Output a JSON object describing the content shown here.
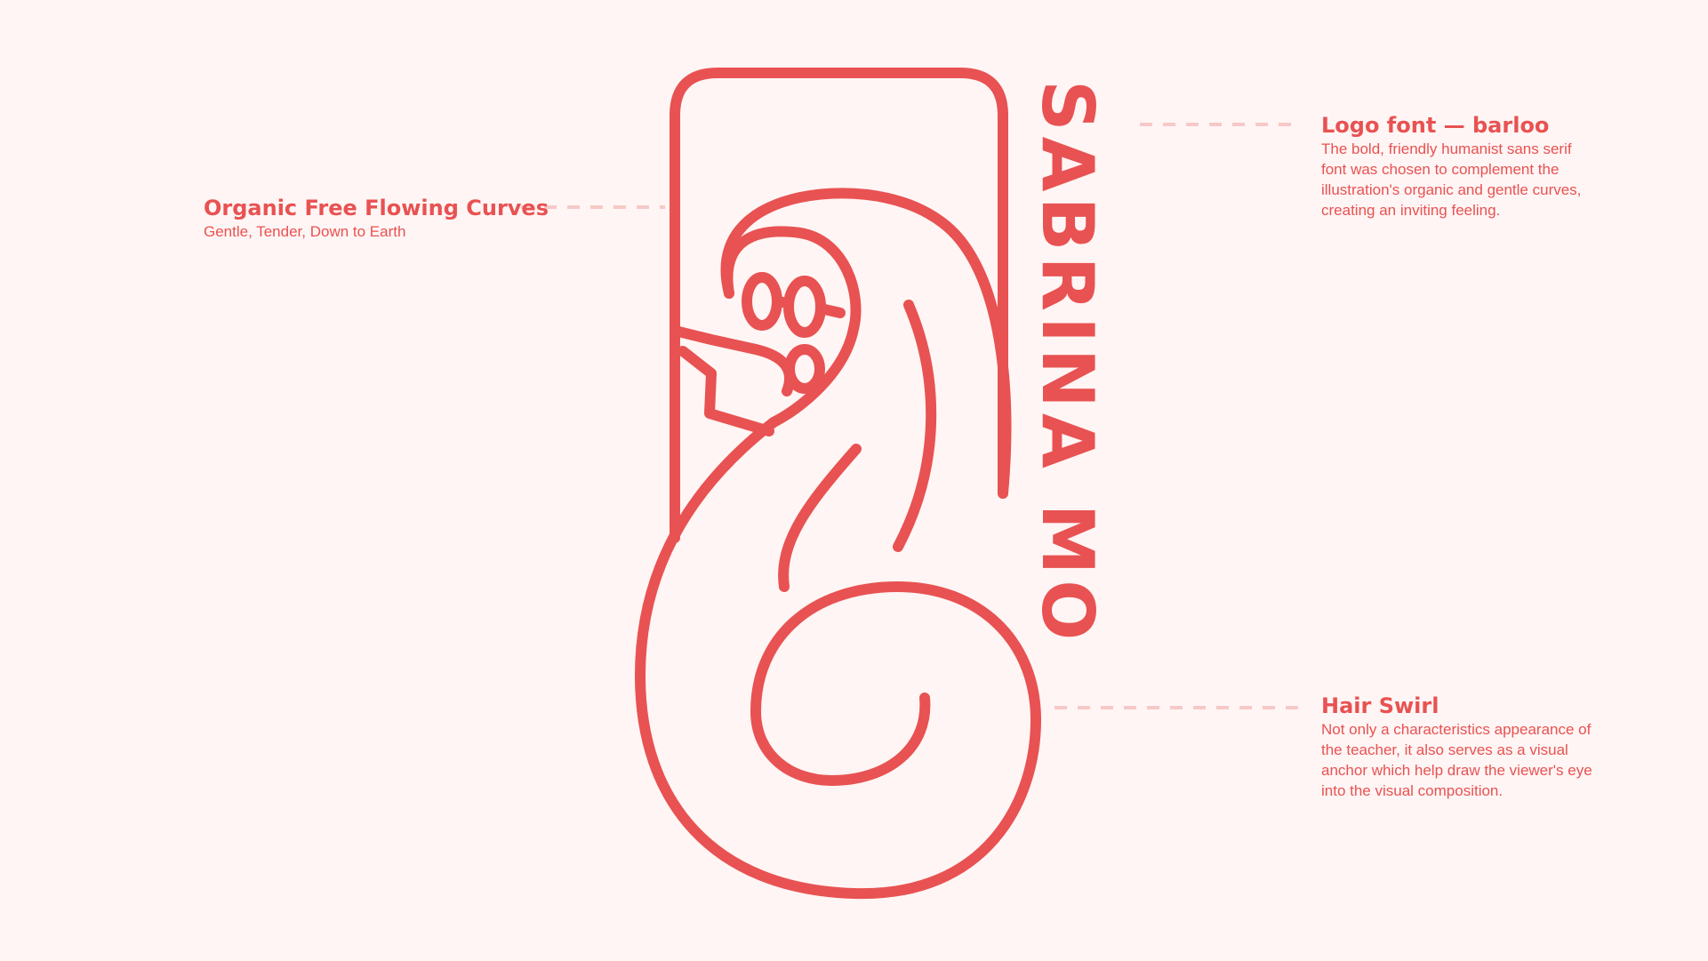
{
  "colors": {
    "background": "#fff5f4",
    "accent": "#e85252",
    "guide_dash": "#f6c9c7"
  },
  "logo": {
    "wordmark": "SABRINA MO"
  },
  "annotations": {
    "curves": {
      "title": "Organic Free Flowing Curves",
      "subtitle": "Gentle, Tender, Down to Earth"
    },
    "font": {
      "title": "Logo font — barloo",
      "description": "The bold, friendly humanist sans serif font was chosen to complement the illustration's organic and gentle curves, creating an inviting feeling."
    },
    "swirl": {
      "title": "Hair Swirl",
      "description": "Not only a characteristics appearance of the teacher, it also serves as a visual anchor which help draw the viewer's eye into the visual composition."
    }
  }
}
